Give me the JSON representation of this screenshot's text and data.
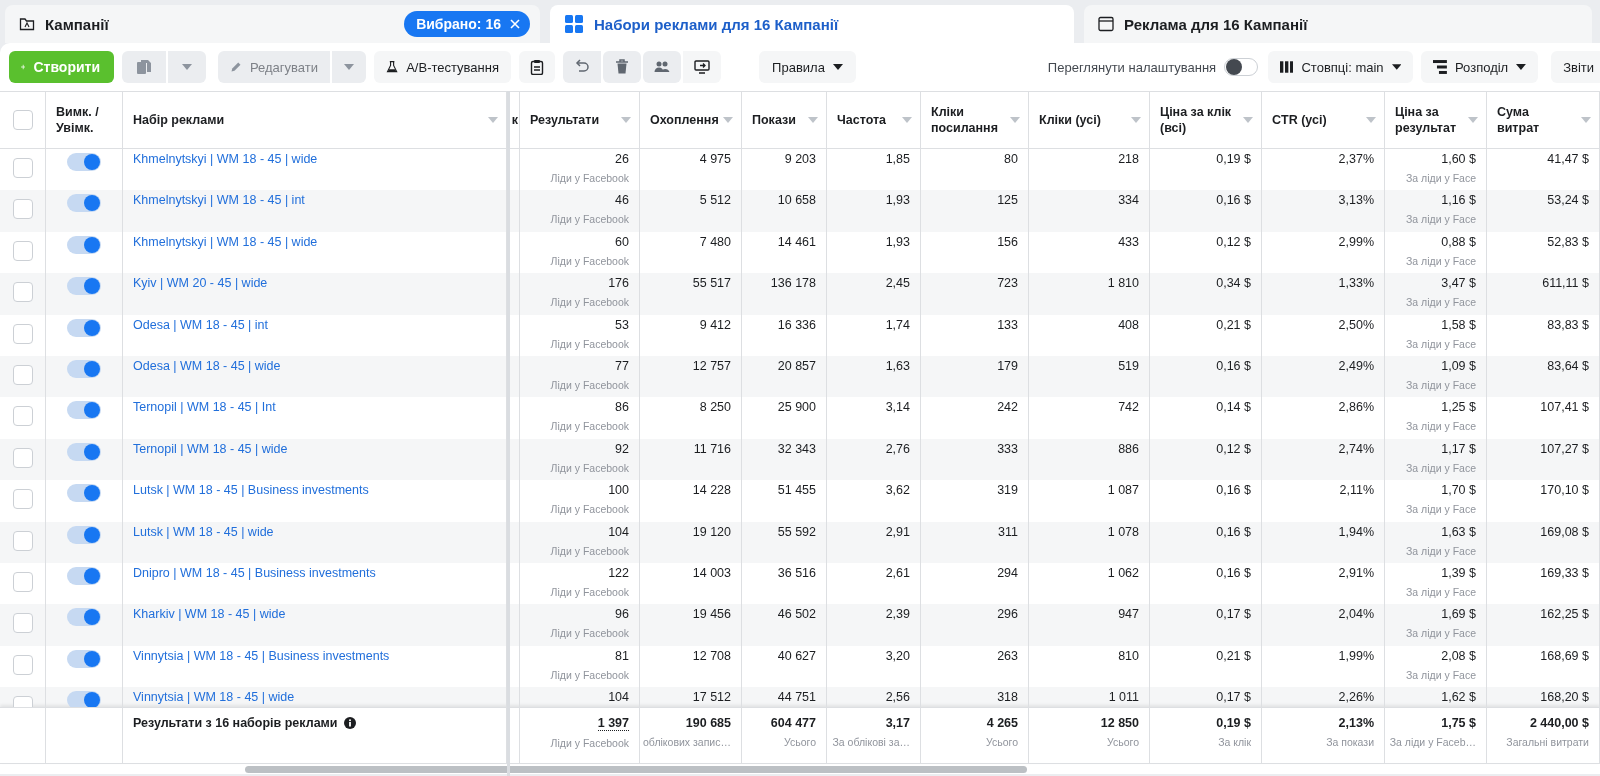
{
  "tabs": [
    {
      "label": "Кампанії",
      "selected": false,
      "badge": "Вибрано: 16"
    },
    {
      "label": "Набори реклами для 16 Кампанії",
      "selected": true
    },
    {
      "label": "Реклама для 16 Кампанії",
      "selected": false
    }
  ],
  "toolbar": {
    "create": "Створити",
    "copy": {
      "disabled": true
    },
    "edit": {
      "label": "Редагувати",
      "disabled": true
    },
    "ab_test": "A/B-тестування",
    "rules": "Правила",
    "preview": {
      "label": "Переглянути налаштування",
      "on": false
    },
    "columns": "Стовпці: main",
    "breakdown": "Розподіл",
    "reports": "Звіти"
  },
  "table": {
    "header_checked": false,
    "toggle_header": "Вимк. / Увімк.",
    "name_header": "Набір реклами",
    "cut_header": "к",
    "columns": [
      "Результати",
      "Охоплення",
      "Покази",
      "Частота",
      "Кліки посилання",
      "Кліки (усі)",
      "Ціна за клік (всі)",
      "CTR (усі)",
      "Ціна за результат",
      "Сума витрат"
    ],
    "rows": [
      {
        "checked": false,
        "on": true,
        "name": "Khmelnytskyi | WM 18 - 45 | wide",
        "cells": [
          "26",
          "4 975",
          "9 203",
          "1,85",
          "80",
          "218",
          "0,19 $",
          "2,37%",
          "1,60 $",
          "41,47 $"
        ],
        "result_note": "Ліди у Facebook",
        "cost_note": "За ліди у Face"
      },
      {
        "checked": false,
        "on": true,
        "name": "Khmelnytskyi | WM 18 - 45 | int",
        "cells": [
          "46",
          "5 512",
          "10 658",
          "1,93",
          "125",
          "334",
          "0,16 $",
          "3,13%",
          "1,16 $",
          "53,24 $"
        ],
        "result_note": "Ліди у Facebook",
        "cost_note": "За ліди у Face"
      },
      {
        "checked": false,
        "on": true,
        "name": "Khmelnytskyi | WM 18 - 45 | wide",
        "cells": [
          "60",
          "7 480",
          "14 461",
          "1,93",
          "156",
          "433",
          "0,12 $",
          "2,99%",
          "0,88 $",
          "52,83 $"
        ],
        "result_note": "Ліди у Facebook",
        "cost_note": "За ліди у Face"
      },
      {
        "checked": false,
        "on": true,
        "name": "Kyiv | WM 20 - 45 | wide",
        "cells": [
          "176",
          "55 517",
          "136 178",
          "2,45",
          "723",
          "1 810",
          "0,34 $",
          "1,33%",
          "3,47 $",
          "611,11 $"
        ],
        "result_note": "Ліди у Facebook",
        "cost_note": "За ліди у Face"
      },
      {
        "checked": false,
        "on": true,
        "name": "Odesa | WM 18 - 45 | int",
        "cells": [
          "53",
          "9 412",
          "16 336",
          "1,74",
          "133",
          "408",
          "0,21 $",
          "2,50%",
          "1,58 $",
          "83,83 $"
        ],
        "result_note": "Ліди у Facebook",
        "cost_note": "За ліди у Face"
      },
      {
        "checked": false,
        "on": true,
        "name": "Odesa | WM 18 - 45 | wide",
        "cells": [
          "77",
          "12 757",
          "20 857",
          "1,63",
          "179",
          "519",
          "0,16 $",
          "2,49%",
          "1,09 $",
          "83,64 $"
        ],
        "result_note": "Ліди у Facebook",
        "cost_note": "За ліди у Face"
      },
      {
        "checked": false,
        "on": true,
        "name": "Ternopil | WM 18 - 45 | Int",
        "cells": [
          "86",
          "8 250",
          "25 900",
          "3,14",
          "242",
          "742",
          "0,14 $",
          "2,86%",
          "1,25 $",
          "107,41 $"
        ],
        "result_note": "Ліди у Facebook",
        "cost_note": "За ліди у Face"
      },
      {
        "checked": false,
        "on": true,
        "name": "Ternopil | WM 18 - 45 | wide",
        "cells": [
          "92",
          "11 716",
          "32 343",
          "2,76",
          "333",
          "886",
          "0,12 $",
          "2,74%",
          "1,17 $",
          "107,27 $"
        ],
        "result_note": "Ліди у Facebook",
        "cost_note": "За ліди у Face"
      },
      {
        "checked": false,
        "on": true,
        "name": "Lutsk | WM 18 - 45 | Business investments",
        "cells": [
          "100",
          "14 228",
          "51 455",
          "3,62",
          "319",
          "1 087",
          "0,16 $",
          "2,11%",
          "1,70 $",
          "170,10 $"
        ],
        "result_note": "Ліди у Facebook",
        "cost_note": "За ліди у Face"
      },
      {
        "checked": false,
        "on": true,
        "name": "Lutsk | WM 18 - 45 | wide",
        "cells": [
          "104",
          "19 120",
          "55 592",
          "2,91",
          "311",
          "1 078",
          "0,16 $",
          "1,94%",
          "1,63 $",
          "169,08 $"
        ],
        "result_note": "Ліди у Facebook",
        "cost_note": "За ліди у Face"
      },
      {
        "checked": false,
        "on": true,
        "name": "Dnipro | WM 18 - 45 | Business investments",
        "cells": [
          "122",
          "14 003",
          "36 516",
          "2,61",
          "294",
          "1 062",
          "0,16 $",
          "2,91%",
          "1,39 $",
          "169,33 $"
        ],
        "result_note": "Ліди у Facebook",
        "cost_note": "За ліди у Face"
      },
      {
        "checked": false,
        "on": true,
        "name": "Kharkiv | WM 18 - 45 | wide",
        "cells": [
          "96",
          "19 456",
          "46 502",
          "2,39",
          "296",
          "947",
          "0,17 $",
          "2,04%",
          "1,69 $",
          "162,25 $"
        ],
        "result_note": "Ліди у Facebook",
        "cost_note": "За ліди у Face"
      },
      {
        "checked": false,
        "on": true,
        "name": "Vinnytsia | WM 18 - 45 | Business investments",
        "cells": [
          "81",
          "12 708",
          "40 627",
          "3,20",
          "263",
          "810",
          "0,21 $",
          "1,99%",
          "2,08 $",
          "168,69 $"
        ],
        "result_note": "Ліди у Facebook",
        "cost_note": "За ліди у Face"
      },
      {
        "checked": false,
        "on": true,
        "name": "Vinnytsia | WM 18 - 45 | wide",
        "cells": [
          "104",
          "17 512",
          "44 751",
          "2,56",
          "318",
          "1 011",
          "0,17 $",
          "2,26%",
          "1,62 $",
          "168,20 $"
        ]
      }
    ],
    "footer": {
      "label": "Результати з 16 наборів реклами",
      "cells": [
        {
          "value": "1 397",
          "note": "Ліди у Facebook"
        },
        {
          "value": "190 685",
          "note": "облікових запис…"
        },
        {
          "value": "604 477",
          "note": "Усього"
        },
        {
          "value": "3,17",
          "note": "За облікові за…"
        },
        {
          "value": "4 265",
          "note": "Усього"
        },
        {
          "value": "12 850",
          "note": "Усього"
        },
        {
          "value": "0,19 $",
          "note": "За клік"
        },
        {
          "value": "2,13%",
          "note": "За покази"
        },
        {
          "value": "1,75 $",
          "note": "За ліди у Faceb…"
        },
        {
          "value": "2 440,00 $",
          "note": "Загальні витрати"
        }
      ]
    }
  }
}
